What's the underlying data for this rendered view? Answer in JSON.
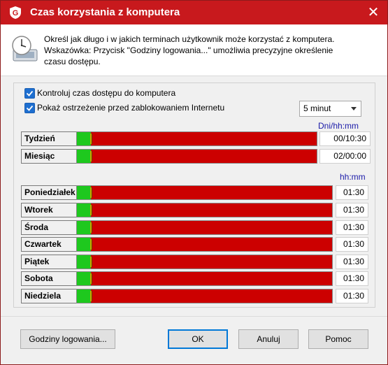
{
  "window": {
    "title": "Czas korzystania z komputera",
    "close_glyph": "✕",
    "logo_letter": "G"
  },
  "info": {
    "line1": "Określ jak długo i w jakich terminach użytkownik może korzystać z komputera.",
    "line2": "Wskazówka: Przycisk \"Godziny logowania...\" umożliwia precyzyjne określenie",
    "line3": "czasu dostępu."
  },
  "options": {
    "control_label": "Kontroluj czas dostępu do komputera",
    "control_checked": true,
    "warn_label": "Pokaż ostrzeżenie przed zablokowaniem Internetu",
    "warn_checked": true,
    "warn_time": "5 minut"
  },
  "totals": {
    "unit": "Dni/hh:mm",
    "rows": [
      {
        "label": "Tydzień",
        "value": "00/10:30"
      },
      {
        "label": "Miesiąc",
        "value": "02/00:00"
      }
    ]
  },
  "days": {
    "unit": "hh:mm",
    "rows": [
      {
        "label": "Poniedziałek",
        "value": "01:30"
      },
      {
        "label": "Wtorek",
        "value": "01:30"
      },
      {
        "label": "Środa",
        "value": "01:30"
      },
      {
        "label": "Czwartek",
        "value": "01:30"
      },
      {
        "label": "Piątek",
        "value": "01:30"
      },
      {
        "label": "Sobota",
        "value": "01:30"
      },
      {
        "label": "Niedziela",
        "value": "01:30"
      }
    ]
  },
  "buttons": {
    "login_hours": "Godziny logowania...",
    "ok": "OK",
    "cancel": "Anuluj",
    "help": "Pomoc"
  },
  "colors": {
    "brand": "#c8191d",
    "allowed": "#1ec81e",
    "blocked": "#cc0000",
    "slider": "#c8a000"
  }
}
